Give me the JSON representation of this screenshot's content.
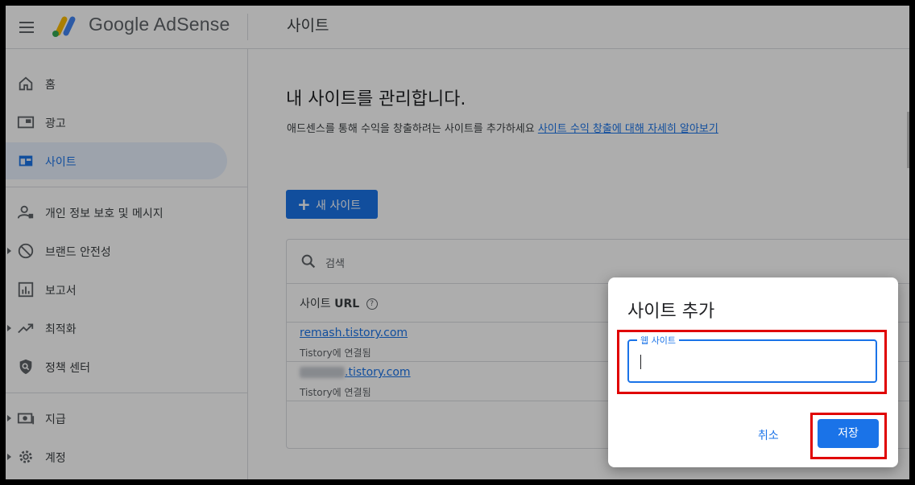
{
  "header": {
    "app_name": "Google AdSense",
    "page_title": "사이트"
  },
  "sidebar": {
    "items": [
      {
        "label": "홈",
        "icon": "home-icon"
      },
      {
        "label": "광고",
        "icon": "ads-icon"
      },
      {
        "label": "사이트",
        "icon": "sites-icon",
        "active": true
      },
      {
        "label": "개인 정보 보호 및 메시지",
        "icon": "privacy-icon"
      },
      {
        "label": "브랜드 안전성",
        "icon": "block-icon",
        "expandable": true
      },
      {
        "label": "보고서",
        "icon": "reports-icon"
      },
      {
        "label": "최적화",
        "icon": "trending-icon",
        "expandable": true
      },
      {
        "label": "정책 센터",
        "icon": "policy-shield-icon"
      },
      {
        "label": "지급",
        "icon": "payments-icon",
        "expandable": true
      },
      {
        "label": "계정",
        "icon": "gear-icon",
        "expandable": true
      }
    ]
  },
  "main": {
    "heading": "내 사이트를 관리합니다.",
    "description": "애드센스를 통해 수익을 창출하려는 사이트를 추가하세요",
    "learn_more_link": "사이트 수익 창출에 대해 자세히 알아보기",
    "add_site_button": "새 사이트",
    "search_placeholder": "검색",
    "table": {
      "column_header_prefix": "사이트",
      "column_header_bold": "URL",
      "rows": [
        {
          "url": "remash.tistory.com",
          "status": "Tistory에 연결됨"
        },
        {
          "url": ".tistory.com",
          "status": "Tistory에 연결됨",
          "redacted_prefix": true
        }
      ]
    }
  },
  "dialog": {
    "title": "사이트 추가",
    "field_label": "웹 사이트",
    "field_value": "",
    "cancel_label": "취소",
    "save_label": "저장"
  },
  "colors": {
    "accent": "#1a73e8",
    "highlight": "#e00000",
    "active_nav_bg": "#e8f0fe"
  }
}
